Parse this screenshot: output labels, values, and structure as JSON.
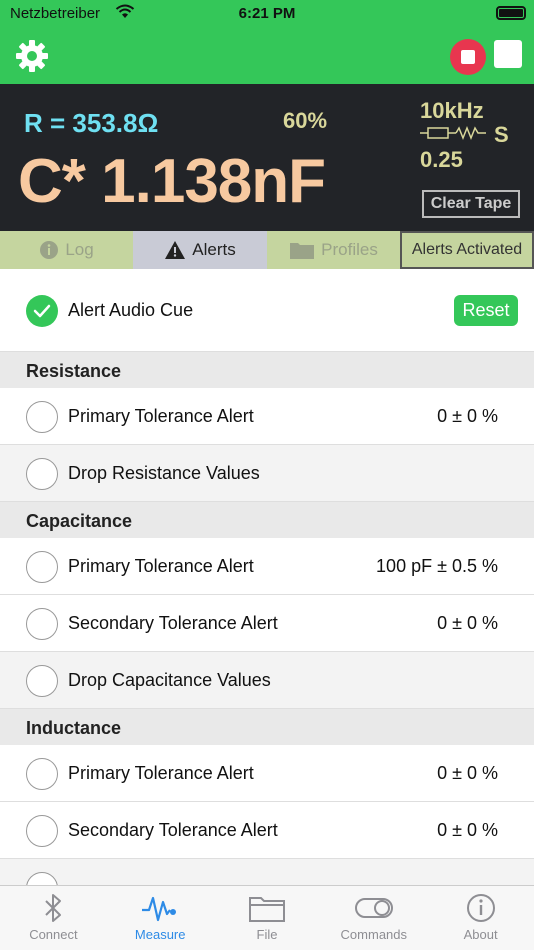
{
  "status": {
    "carrier": "Netzbetreiber",
    "time": "6:21 PM"
  },
  "display": {
    "resistance": "R = 353.8Ω",
    "percent": "60%",
    "capacitance": "C* 1.138nF",
    "frequency": "10kHz",
    "mode": "S",
    "dvalue": "0.25",
    "clear_tape": "Clear Tape"
  },
  "tabs": {
    "log": "Log",
    "alerts": "Alerts",
    "profiles": "Profiles",
    "activated": "Alerts Activated"
  },
  "alert_audio": {
    "label": "Alert Audio Cue",
    "reset": "Reset"
  },
  "sections": {
    "resistance": {
      "title": "Resistance",
      "primary": {
        "label": "Primary Tolerance Alert",
        "value": "0 ± 0 %"
      },
      "drop": "Drop Resistance Values"
    },
    "capacitance": {
      "title": "Capacitance",
      "primary": {
        "label": "Primary Tolerance Alert",
        "value": "100 pF ± 0.5 %"
      },
      "secondary": {
        "label": "Secondary Tolerance Alert",
        "value": "0 ± 0 %"
      },
      "drop": "Drop Capacitance Values"
    },
    "inductance": {
      "title": "Inductance",
      "primary": {
        "label": "Primary Tolerance Alert",
        "value": "0 ± 0 %"
      },
      "secondary": {
        "label": "Secondary Tolerance Alert",
        "value": "0 ± 0 %"
      }
    }
  },
  "tabbar": {
    "connect": "Connect",
    "measure": "Measure",
    "file": "File",
    "commands": "Commands",
    "about": "About"
  },
  "colors": {
    "accent": "#34c759",
    "record": "#e8364f",
    "active_tab": "#2e8be6"
  },
  "icons": [
    "gear-icon",
    "record-icon",
    "stop-icon",
    "info-icon",
    "warning-icon",
    "folder-icon",
    "checkmark-icon",
    "bluetooth-icon",
    "waveform-icon",
    "toggle-icon"
  ]
}
